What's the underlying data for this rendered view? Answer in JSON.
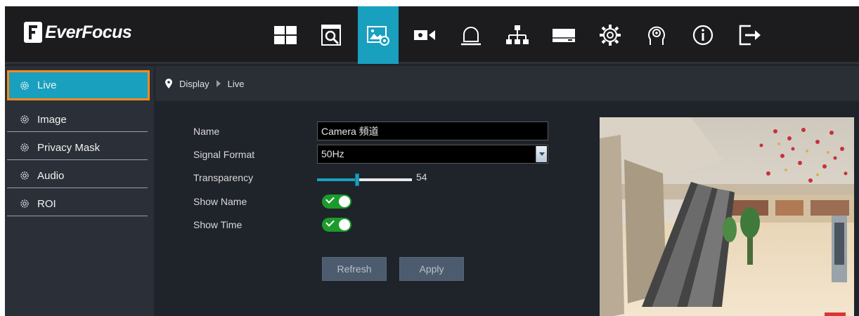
{
  "app": {
    "brand": "EverFocus",
    "accent_color": "#1aa0bf",
    "highlight_color": "#f28b1e",
    "nav": [
      {
        "icon": "live-view-grid-icon",
        "active": false
      },
      {
        "icon": "playback-search-icon",
        "active": false
      },
      {
        "icon": "display-settings-icon",
        "active": true
      },
      {
        "icon": "record-camera-icon",
        "active": false
      },
      {
        "icon": "alarm-bell-icon",
        "active": false
      },
      {
        "icon": "network-icon",
        "active": false
      },
      {
        "icon": "storage-device-icon",
        "active": false
      },
      {
        "icon": "system-gear-icon",
        "active": false
      },
      {
        "icon": "user-settings-icon",
        "active": false
      },
      {
        "icon": "info-icon",
        "active": false
      },
      {
        "icon": "logout-icon",
        "active": false
      }
    ]
  },
  "sidebar": {
    "items": [
      {
        "label": "Live",
        "icon": "gear-icon",
        "active": true
      },
      {
        "label": "Image",
        "icon": "gear-icon",
        "active": false
      },
      {
        "label": "Privacy Mask",
        "icon": "gear-icon",
        "active": false
      },
      {
        "label": "Audio",
        "icon": "gear-icon",
        "active": false
      },
      {
        "label": "ROI",
        "icon": "gear-icon",
        "active": false
      }
    ]
  },
  "breadcrumb": {
    "icon": "location-pin-icon",
    "parent": "Display",
    "current": "Live"
  },
  "form": {
    "name_label": "Name",
    "name_value": "Camera 頻道",
    "signal_format_label": "Signal Format",
    "signal_format_value": "50Hz",
    "transparency_label": "Transparency",
    "transparency_value": "54",
    "transparency_fraction": 0.4,
    "show_name_label": "Show Name",
    "show_name_on": true,
    "show_time_label": "Show Time",
    "show_time_on": true
  },
  "buttons": {
    "refresh": "Refresh",
    "apply": "Apply"
  }
}
